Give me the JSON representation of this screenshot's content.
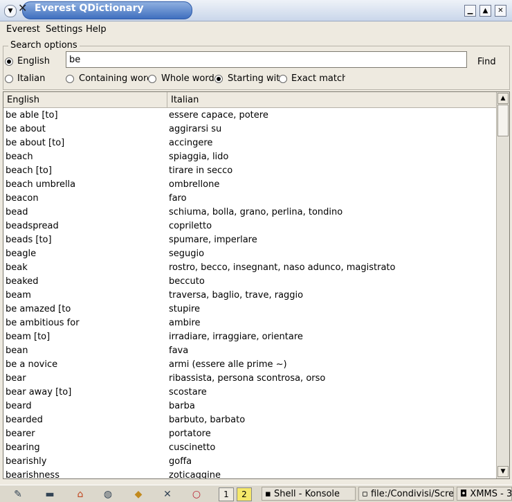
{
  "window": {
    "title": "Everest QDictionary"
  },
  "menu": [
    "Everest",
    "Settings",
    "Help"
  ],
  "search_options": {
    "label": "Search options",
    "languages": [
      {
        "label": "English",
        "selected": true
      },
      {
        "label": "Italian",
        "selected": false
      }
    ],
    "query": "be",
    "find_label": "Find",
    "modes": [
      {
        "label": "Containing word",
        "selected": false
      },
      {
        "label": "Whole word",
        "selected": false
      },
      {
        "label": "Starting with",
        "selected": true
      },
      {
        "label": "Exact match",
        "selected": false
      }
    ]
  },
  "results": {
    "columns": [
      "English",
      "Italian"
    ],
    "rows": [
      [
        "be able [to]",
        "essere capace, potere"
      ],
      [
        "be about",
        "aggirarsi su"
      ],
      [
        "be about [to]",
        "accingere"
      ],
      [
        "beach",
        "spiaggia, lido"
      ],
      [
        "beach [to]",
        "tirare in secco"
      ],
      [
        "beach umbrella",
        "ombrellone"
      ],
      [
        "beacon",
        "faro"
      ],
      [
        "bead",
        "schiuma, bolla, grano, perlina, tondino"
      ],
      [
        "beadspread",
        "copriletto"
      ],
      [
        "beads [to]",
        "spumare, imperlare"
      ],
      [
        "beagle",
        "segugio"
      ],
      [
        "beak",
        "rostro, becco, insegnant, naso adunco, magistrato"
      ],
      [
        "beaked",
        "beccuto"
      ],
      [
        "beam",
        "traversa, baglio, trave, raggio"
      ],
      [
        "be amazed [to",
        "stupire"
      ],
      [
        "be ambitious for",
        "ambire"
      ],
      [
        "beam [to]",
        "irradiare, irraggiare, orientare"
      ],
      [
        "bean",
        "fava"
      ],
      [
        "be a novice",
        "armi (essere alle prime ~)"
      ],
      [
        "bear",
        "ribassista, persona scontrosa, orso"
      ],
      [
        "bear away [to]",
        "scostare"
      ],
      [
        "beard",
        "barba"
      ],
      [
        "bearded",
        "barbuto, barbato"
      ],
      [
        "bearer",
        "portatore"
      ],
      [
        "bearing",
        "cuscinetto"
      ],
      [
        "bearishly",
        "goffa"
      ],
      [
        "bearishness",
        "zoticaggine"
      ]
    ]
  },
  "taskbar": {
    "desktops": [
      "1",
      "2"
    ],
    "active_desktop": "2",
    "tasks": [
      "Shell - Konsole",
      "file:/Condivisi/Scree",
      "XMMS - 3"
    ]
  }
}
